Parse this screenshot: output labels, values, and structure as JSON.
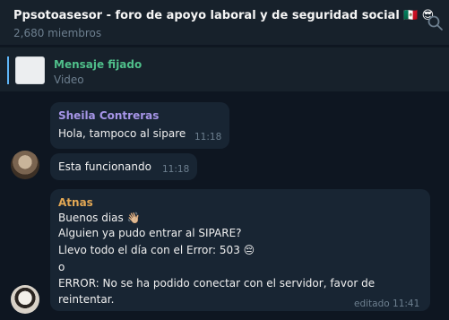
{
  "header": {
    "title": "Ppsotoasesor - foro de apoyo laboral y de seguridad social",
    "title_emojis": "🇲🇽 😎",
    "members": "2,680 miembros"
  },
  "pinned": {
    "label": "Mensaje fijado",
    "subtitle": "Video"
  },
  "messages": [
    {
      "sender": "Sheila Contreras",
      "sender_color": "#a695e7",
      "text": "Hola, tampoco al sipare",
      "time": "11:18"
    },
    {
      "text": "Esta funcionando",
      "time": "11:18"
    },
    {
      "sender": "Atnas",
      "sender_color": "#e2a754",
      "lines": [
        "Buenos dias 👋🏼",
        "Alguien ya pudo entrar al SIPARE?",
        "Llevo todo el día con el Error: 503 😔",
        "o",
        "ERROR: No se ha podido conectar con el servidor, favor de",
        "reintentar."
      ],
      "time": "editado 11:41"
    }
  ],
  "colors": {
    "background": "#0e1621",
    "header": "#17212b",
    "bubble": "#182533",
    "pinned_accent": "#4fbf8a"
  },
  "icons": {
    "search": "search-icon"
  }
}
